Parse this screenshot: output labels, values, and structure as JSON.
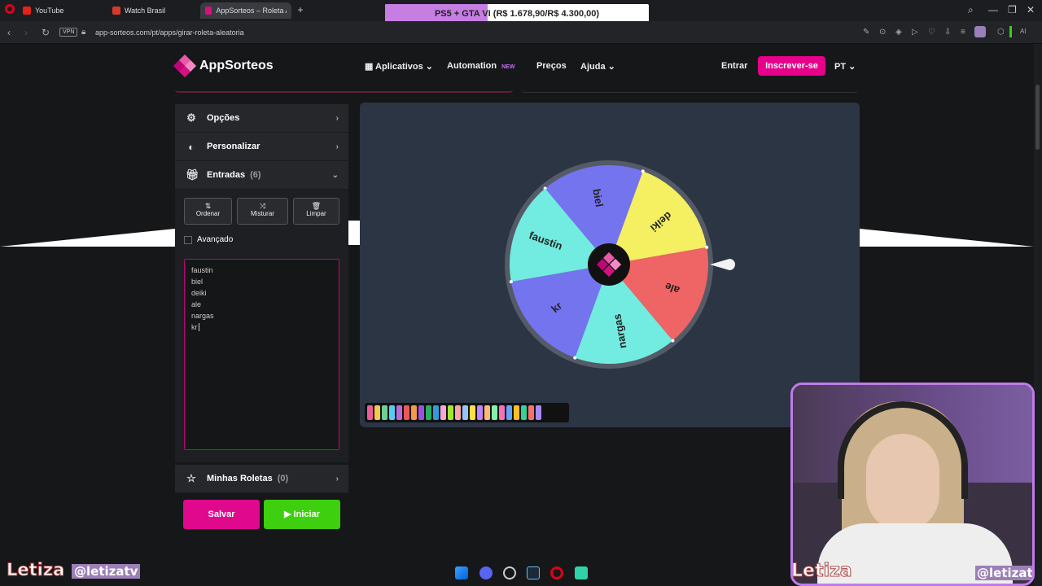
{
  "browser": {
    "tabs": [
      {
        "label": "YouTube",
        "color": "#e62117"
      },
      {
        "label": "Watch Brasil",
        "color": "#d33a2c"
      },
      {
        "label": "AppSorteos – Roleta Alea",
        "color": "#d3127d"
      }
    ],
    "url": "app-sorteos.com/pt/apps/girar-roleta-aleatoria",
    "vpn": "VPN",
    "promo": {
      "text": "PS5 + GTA VI (R$ 1.678,90/R$ 4.300,00)",
      "progress": 0.39
    }
  },
  "header": {
    "logo": "AppSorteos",
    "nav": {
      "apps": "Aplicativos",
      "automation": "Automation",
      "new_badge": "NEW",
      "prices": "Preços",
      "help": "Ajuda"
    },
    "login": "Entrar",
    "signup": "Inscrever-se",
    "lang": "PT"
  },
  "sidebar": {
    "options": "Opções",
    "customize": "Personalizar",
    "entries": "Entradas",
    "entries_count": "(6)",
    "sort": "Ordenar",
    "shuffle": "Misturar",
    "clear": "Limpar",
    "advanced": "Avançado",
    "entry_list": [
      "faustin",
      "biel",
      "deiki",
      "ale",
      "nargas",
      "kr"
    ],
    "my_wheels": "Minhas Roletas",
    "my_wheels_count": "(0)",
    "save": "Salvar",
    "start": "Iniciar"
  },
  "wheel": {
    "segments": [
      {
        "label": "biel",
        "color": "#7474ef"
      },
      {
        "label": "deiki",
        "color": "#f5ef62"
      },
      {
        "label": "ale",
        "color": "#ef6464"
      },
      {
        "label": "nargas",
        "color": "#72ebe0"
      },
      {
        "label": "kr",
        "color": "#7474ef"
      },
      {
        "label": "faustin",
        "color": "#72ebe0"
      }
    ],
    "palette": [
      "#e85d9a",
      "#f2c94c",
      "#6fcf97",
      "#56ccf2",
      "#bb6bd9",
      "#eb5757",
      "#f2994a",
      "#9b51e0",
      "#27ae60",
      "#2d9cdb",
      "#f9a8d4",
      "#a3e635",
      "#fca5a5",
      "#93c5fd",
      "#fde047",
      "#c084fc",
      "#fdba74",
      "#86efac",
      "#f472b6",
      "#60a5fa",
      "#fbbf24",
      "#34d399",
      "#f87171",
      "#a78bfa"
    ]
  },
  "stream": {
    "name": "Letiza",
    "handle": "@letizatv"
  }
}
